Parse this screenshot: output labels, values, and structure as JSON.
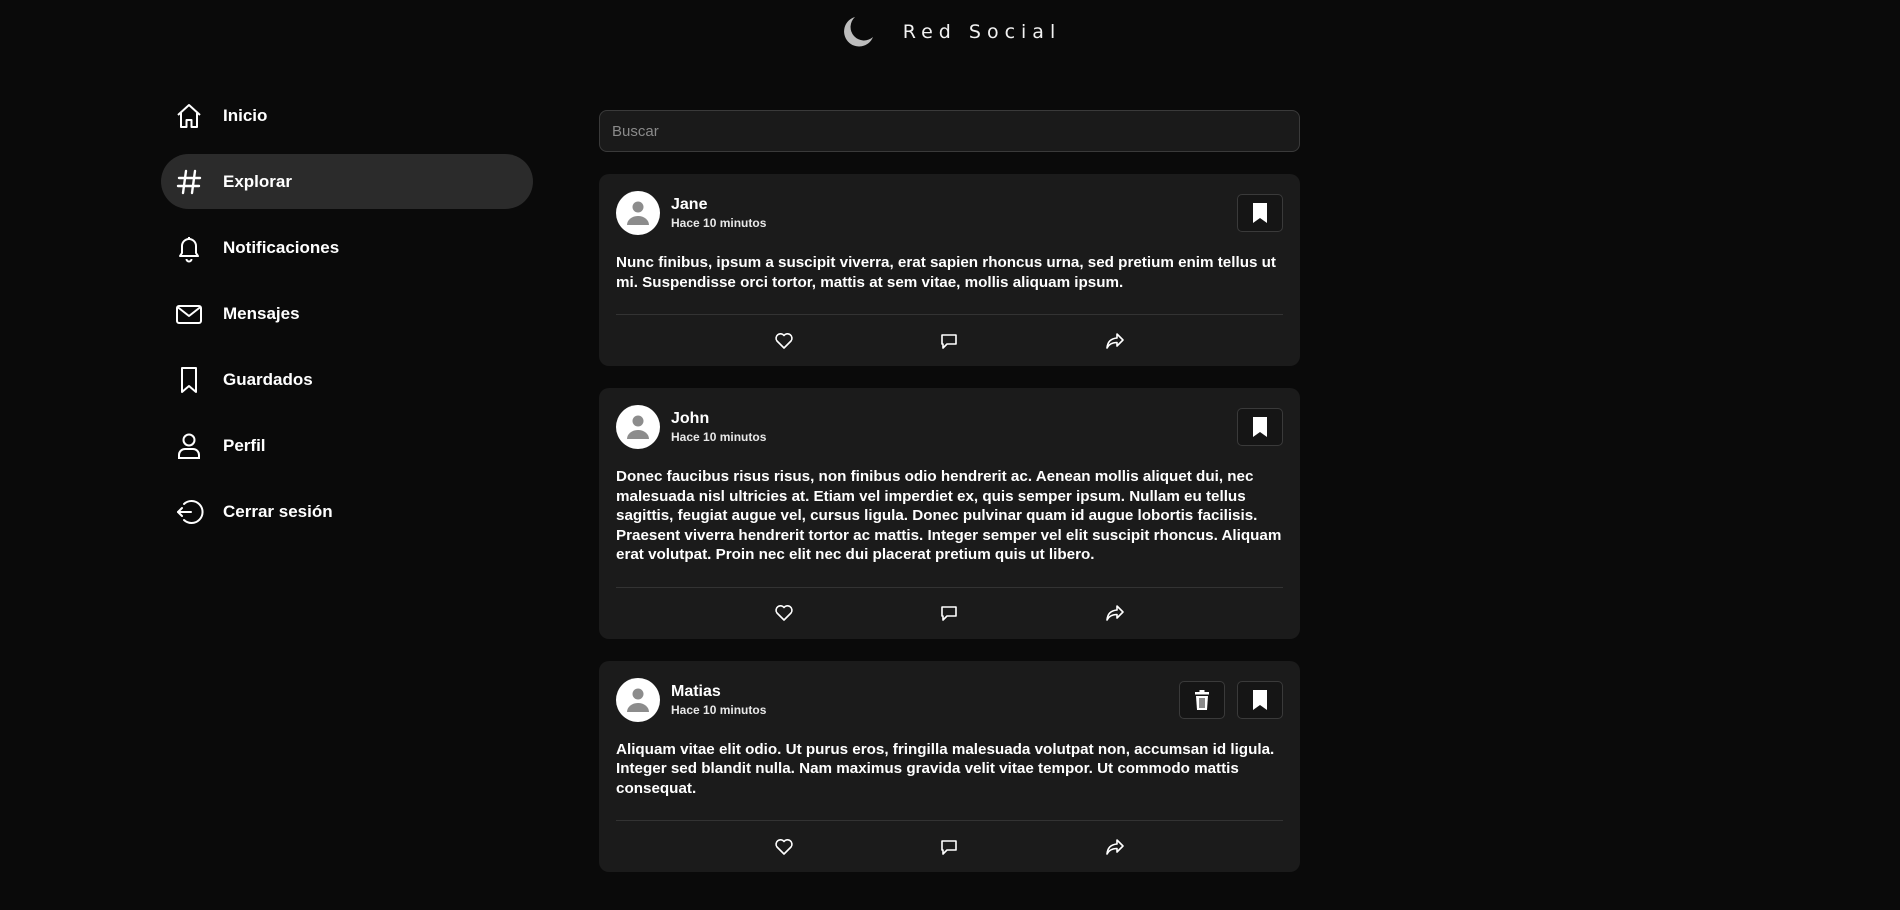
{
  "header": {
    "brand": "Red Social",
    "theme_icon": "moon-icon"
  },
  "sidebar": {
    "items": [
      {
        "label": "Inicio",
        "icon": "home-icon",
        "active": false
      },
      {
        "label": "Explorar",
        "icon": "hashtag-icon",
        "active": true
      },
      {
        "label": "Notificaciones",
        "icon": "bell-icon",
        "active": false
      },
      {
        "label": "Mensajes",
        "icon": "envelope-icon",
        "active": false
      },
      {
        "label": "Guardados",
        "icon": "bookmark-icon",
        "active": false
      },
      {
        "label": "Perfil",
        "icon": "user-icon",
        "active": false
      },
      {
        "label": "Cerrar sesión",
        "icon": "logout-icon",
        "active": false
      }
    ]
  },
  "search": {
    "placeholder": "Buscar",
    "value": ""
  },
  "posts": [
    {
      "author": "Jane",
      "time": "Hace 10 minutos",
      "text": "Nunc finibus, ipsum a suscipit viverra, erat sapien rhoncus urna, sed pretium enim tellus ut mi. Suspendisse orci tortor, mattis at sem vitae, mollis aliquam ipsum.",
      "can_delete": false
    },
    {
      "author": "John",
      "time": "Hace 10 minutos",
      "text": "Donec faucibus risus risus, non finibus odio hendrerit ac. Aenean mollis aliquet dui, nec malesuada nisl ultricies at. Etiam vel imperdiet ex, quis semper ipsum. Nullam eu tellus sagittis, feugiat augue vel, cursus ligula. Donec pulvinar quam id augue lobortis facilisis. Praesent viverra hendrerit tortor ac mattis. Integer semper vel elit suscipit rhoncus. Aliquam erat volutpat. Proin nec elit nec dui placerat pretium quis ut libero.",
      "can_delete": false
    },
    {
      "author": "Matias",
      "time": "Hace 10 minutos",
      "text": "Aliquam vitae elit odio. Ut purus eros, fringilla malesuada volutpat non, accumsan id ligula. Integer sed blandit nulla. Nam maximus gravida velit vitae tempor. Ut commodo mattis consequat.",
      "can_delete": true
    }
  ],
  "colors": {
    "background": "#0a0a0a",
    "card": "#1b1b1b",
    "active_nav": "#2b2b2b"
  }
}
